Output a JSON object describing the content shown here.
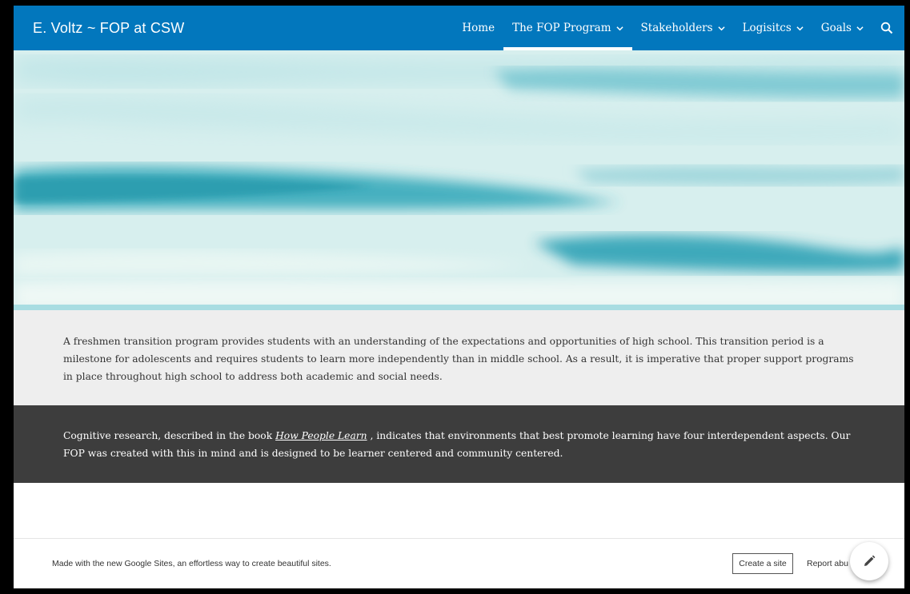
{
  "header": {
    "site_title": "E. Voltz ~ FOP at CSW",
    "nav": [
      {
        "label": "Home",
        "dropdown": false,
        "active": false
      },
      {
        "label": "The FOP Program",
        "dropdown": true,
        "active": true
      },
      {
        "label": "Stakeholders",
        "dropdown": true,
        "active": false
      },
      {
        "label": "Logisitcs",
        "dropdown": true,
        "active": false
      },
      {
        "label": "Goals",
        "dropdown": true,
        "active": false
      }
    ],
    "search_icon": "search-icon"
  },
  "intro": {
    "text": "A freshmen transition program provides students with an understanding of the expectations and opportunities of high school. This transition period is a milestone for adolescents and requires students to learn more independently than in middle school. As a result, it is imperative that proper support programs in place throughout high school to address both academic and social needs."
  },
  "research": {
    "text_before": "Cognitive research, described in the book ",
    "book_title": "How People Learn",
    "text_after": " , indicates that environments that best promote learning have four interdependent aspects. Our FOP was created with this in mind and is designed to be learner centered and community centered."
  },
  "footer": {
    "made_with": "Made with the new Google Sites, an effortless way to create beautiful sites.",
    "create_site": "Create a site",
    "report_abuse": "Report abu"
  },
  "fab_icon": "pencil-edit-icon",
  "colors": {
    "header_bg": "#0277bd",
    "intro_bg": "#eeeeee",
    "dark_bg": "#3d3d3d"
  }
}
